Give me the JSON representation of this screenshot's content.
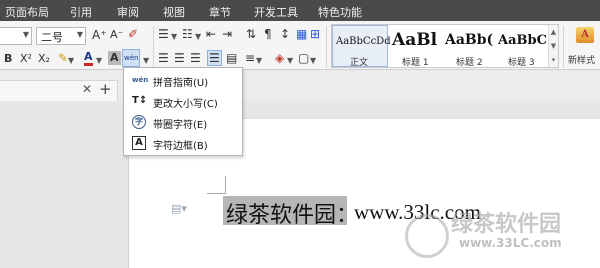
{
  "menubar": {
    "items": [
      "页面布局",
      "引用",
      "审阅",
      "视图",
      "章节",
      "开发工具",
      "特色功能"
    ]
  },
  "ribbon": {
    "font_size_value": "二号",
    "grow_font_label": "A⁺",
    "shrink_font_label": "A⁻",
    "superscript_label": "X²",
    "subscript_label": "X₂",
    "font_color_label": "A",
    "char_shading_label": "A",
    "phonetic_label": "wén",
    "styles": [
      {
        "sample": "AaBbCcDd",
        "label": "正文"
      },
      {
        "sample": "AaBl",
        "label": "标题 1"
      },
      {
        "sample": "AaBb(",
        "label": "标题 2"
      },
      {
        "sample": "AaBbC",
        "label": "标题 3"
      }
    ],
    "new_style_label": "新样式"
  },
  "dropdown": {
    "items": [
      {
        "icon": "wén",
        "label": "拼音指南(U)"
      },
      {
        "icon": "T↕",
        "label": "更改大小写(C)"
      },
      {
        "icon": "字",
        "label": "带圈字符(E)"
      },
      {
        "icon": "A",
        "label": "字符边框(B)"
      }
    ]
  },
  "document": {
    "selected_text": "绿茶软件园：",
    "rest_text": "www.33lc.com"
  },
  "watermark": {
    "title": "绿茶软件园",
    "url": "www.33LC.com"
  },
  "colors": {
    "menubar_bg": "#4a4a4a",
    "selection_bg": "#b6b6b6",
    "accent_blue": "#2a5bd7",
    "font_color_red": "#d4262b"
  }
}
